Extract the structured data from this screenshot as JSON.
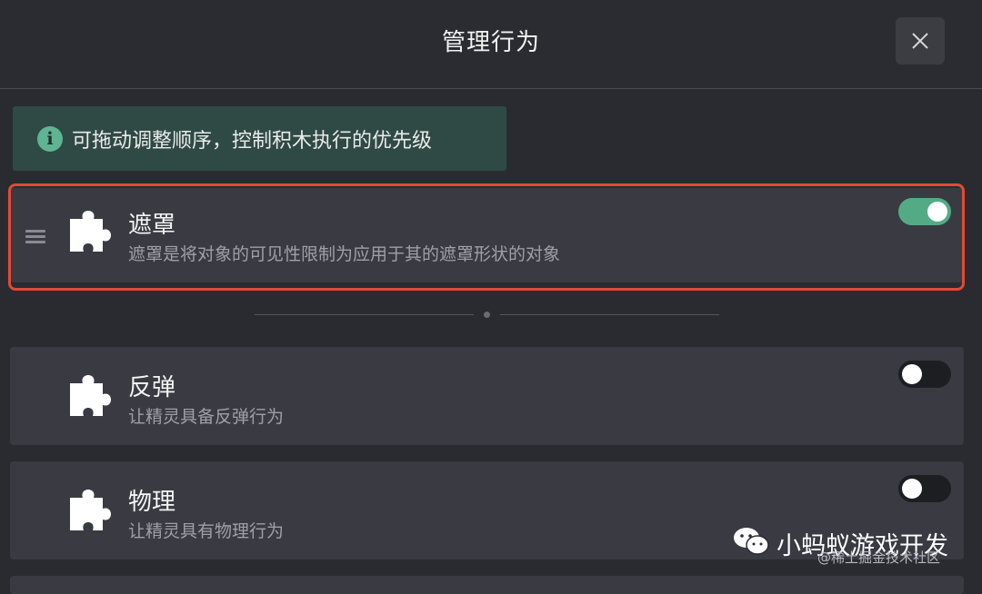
{
  "dialog": {
    "title": "管理行为",
    "close_icon": "close-icon"
  },
  "hint": {
    "icon": "info-icon",
    "icon_glyph": "i",
    "text": "可拖动调整顺序，控制积木执行的优先级"
  },
  "behaviors": [
    {
      "name": "遮罩",
      "description": "遮罩是将对象的可见性限制为应用于其的遮罩形状的对象",
      "enabled": true,
      "selected": true
    },
    {
      "name": "反弹",
      "description": "让精灵具备反弹行为",
      "enabled": false,
      "selected": false
    },
    {
      "name": "物理",
      "description": "让精灵具有物理行为",
      "enabled": false,
      "selected": false
    }
  ],
  "watermark": {
    "label": "小蚂蚁游戏开发",
    "source": "@稀土掘金技术社区"
  },
  "colors": {
    "accent": "#53ab86",
    "highlight_border": "#e04b35",
    "card_bg": "#393a42",
    "page_bg": "#2a2b30"
  }
}
